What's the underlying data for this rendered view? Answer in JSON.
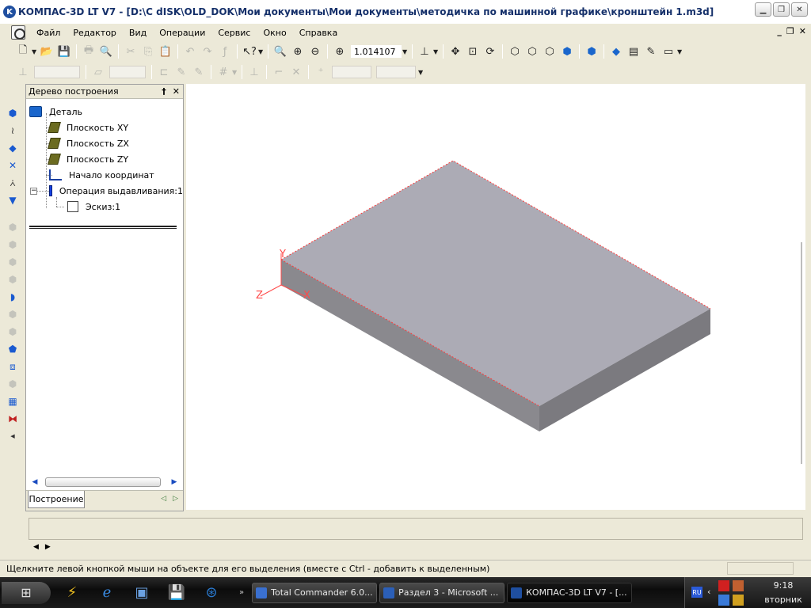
{
  "window": {
    "title": "КОМПАС-3D LT V7 - [D:\\C dISK\\OLD_DOK\\Мои документы\\Мои документы\\методичка по машинной графике\\кронштейн 1.m3d]",
    "app_icon_letter": "K"
  },
  "menu": {
    "items": [
      "Файл",
      "Редактор",
      "Вид",
      "Операции",
      "Сервис",
      "Окно",
      "Справка"
    ]
  },
  "toolbar": {
    "zoom_value": "1.014107"
  },
  "tree_panel": {
    "title": "Дерево построения",
    "pin_glyph": "†",
    "close_glyph": "✕",
    "nodes": [
      {
        "label": "Деталь"
      },
      {
        "label": "Плоскость XY"
      },
      {
        "label": "Плоскость ZX"
      },
      {
        "label": "Плоскость ZY"
      },
      {
        "label": "Начало координат"
      },
      {
        "label": "Операция выдавливания:1"
      },
      {
        "label": "Эскиз:1"
      }
    ],
    "tab_label": "Построение"
  },
  "viewport": {
    "axis_labels": {
      "x": "X",
      "y": "Y",
      "z": "Z"
    },
    "box_colors": {
      "top": "#acabb5",
      "front": "#8a898e",
      "right": "#7b7a7f",
      "edge": "#ff3b3b"
    }
  },
  "status": {
    "hint": "Щелкните левой кнопкой мыши на объекте для его выделения (вместе с Ctrl - добавить к выделенным)"
  },
  "taskbar": {
    "tasks": [
      {
        "label": "Total Commander 6.0...",
        "color": "#3a70d0"
      },
      {
        "label": "Раздел 3 - Microsoft ...",
        "color": "#2b5fb8"
      },
      {
        "label": "КОМПАС-3D LT V7 - [...",
        "color": "#1f4fa0"
      }
    ],
    "lang": "RU",
    "time": "9:18",
    "day": "вторник"
  }
}
